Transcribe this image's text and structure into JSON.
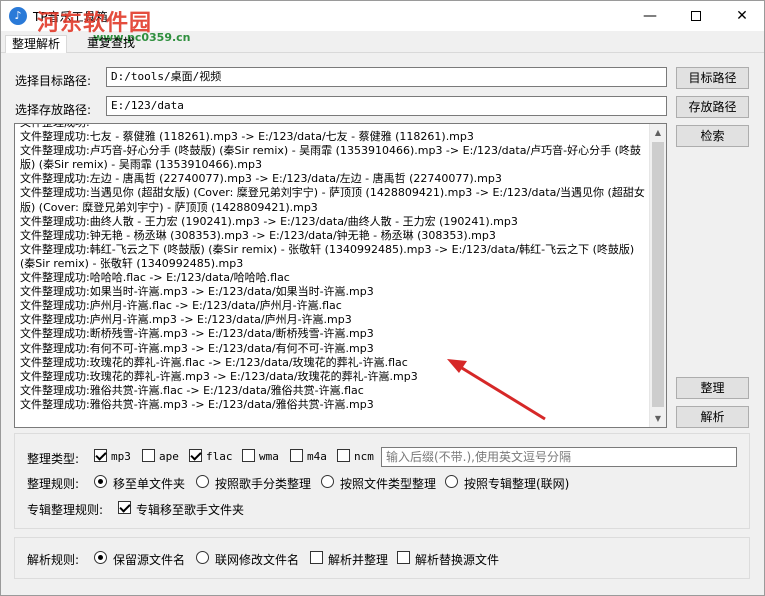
{
  "window": {
    "title": "TP音乐工具箱",
    "watermark": "河东软件园",
    "watermark_url": "www.pc0359.cn"
  },
  "tabs": [
    {
      "label": "整理解析"
    },
    {
      "label": "重复查找"
    }
  ],
  "paths": {
    "target_label": "选择目标路径:",
    "target_value": "D:/tools/桌面/视频",
    "target_button": "目标路径",
    "save_label": "选择存放路径:",
    "save_value": "E:/123/data",
    "save_button": "存放路径"
  },
  "buttons": {
    "search": "检索",
    "organize": "整理",
    "parse": "解析"
  },
  "log": {
    "lines": [
      "文件整理成功:",
      "文件整理成功:七友 - 蔡健雅 (118261).mp3 -> E:/123/data/七友 - 蔡健雅 (118261).mp3",
      "文件整理成功:卢巧音-好心分手 (咚鼓版) (秦Sir remix) - 吴雨霏 (1353910466).mp3 -> E:/123/data/卢巧音-好心分手 (咚鼓版) (秦Sir remix) - 吴雨霏 (1353910466).mp3",
      "文件整理成功:左边 - 唐禹哲 (22740077).mp3 -> E:/123/data/左边 - 唐禹哲 (22740077).mp3",
      "文件整理成功:当遇见你 (超甜女版) (Cover: 糜登兄弟刘宇宁) - 萨顶顶 (1428809421).mp3 -> E:/123/data/当遇见你 (超甜女版) (Cover: 糜登兄弟刘宇宁) - 萨顶顶 (1428809421).mp3",
      "文件整理成功:曲终人散 - 王力宏 (190241).mp3 -> E:/123/data/曲终人散 - 王力宏 (190241).mp3",
      "文件整理成功:钟无艳 - 杨丞琳 (308353).mp3 -> E:/123/data/钟无艳 - 杨丞琳 (308353).mp3",
      "文件整理成功:韩红-飞云之下 (咚鼓版) (秦Sir remix) - 张敬轩 (1340992485).mp3 -> E:/123/data/韩红-飞云之下 (咚鼓版) (秦Sir remix) - 张敬轩 (1340992485).mp3",
      "文件整理成功:哈哈哈.flac -> E:/123/data/哈哈哈.flac",
      "文件整理成功:如果当时-许嵩.mp3 -> E:/123/data/如果当时-许嵩.mp3",
      "文件整理成功:庐州月-许嵩.flac -> E:/123/data/庐州月-许嵩.flac",
      "文件整理成功:庐州月-许嵩.mp3 -> E:/123/data/庐州月-许嵩.mp3",
      "文件整理成功:断桥残雪-许嵩.mp3 -> E:/123/data/断桥残雪-许嵩.mp3",
      "文件整理成功:有何不可-许嵩.mp3 -> E:/123/data/有何不可-许嵩.mp3",
      "文件整理成功:玫瑰花的葬礼-许嵩.flac -> E:/123/data/玫瑰花的葬礼-许嵩.flac",
      "文件整理成功:玫瑰花的葬礼-许嵩.mp3 -> E:/123/data/玫瑰花的葬礼-许嵩.mp3",
      "文件整理成功:雅俗共赏-许嵩.flac -> E:/123/data/雅俗共赏-许嵩.flac",
      "文件整理成功:雅俗共赏-许嵩.mp3 -> E:/123/data/雅俗共赏-许嵩.mp3"
    ]
  },
  "organize": {
    "type_label": "整理类型:",
    "formats": [
      {
        "label": "mp3",
        "checked": true
      },
      {
        "label": "ape",
        "checked": false
      },
      {
        "label": "flac",
        "checked": true
      },
      {
        "label": "wma",
        "checked": false
      },
      {
        "label": "m4a",
        "checked": false
      },
      {
        "label": "ncm",
        "checked": false
      }
    ],
    "ext_placeholder": "输入后缀(不带.),使用英文逗号分隔",
    "rule_label": "整理规则:",
    "rules": [
      {
        "label": "移至单文件夹",
        "selected": true
      },
      {
        "label": "按照歌手分类整理",
        "selected": false
      },
      {
        "label": "按照文件类型整理",
        "selected": false
      },
      {
        "label": "按照专辑整理(联网)",
        "selected": false
      }
    ],
    "album_label": "专辑整理规则:",
    "album_option": {
      "label": "专辑移至歌手文件夹",
      "checked": true
    }
  },
  "parse": {
    "rule_label": "解析规则:",
    "options": [
      {
        "label": "保留源文件名",
        "kind": "radio",
        "selected": true
      },
      {
        "label": "联网修改文件名",
        "kind": "radio",
        "selected": false
      },
      {
        "label": "解析并整理",
        "kind": "check",
        "selected": false
      },
      {
        "label": "解析替换源文件",
        "kind": "check",
        "selected": false
      }
    ]
  },
  "colors": {
    "arrow": "#d62828",
    "watermark": "#e23a2a"
  }
}
